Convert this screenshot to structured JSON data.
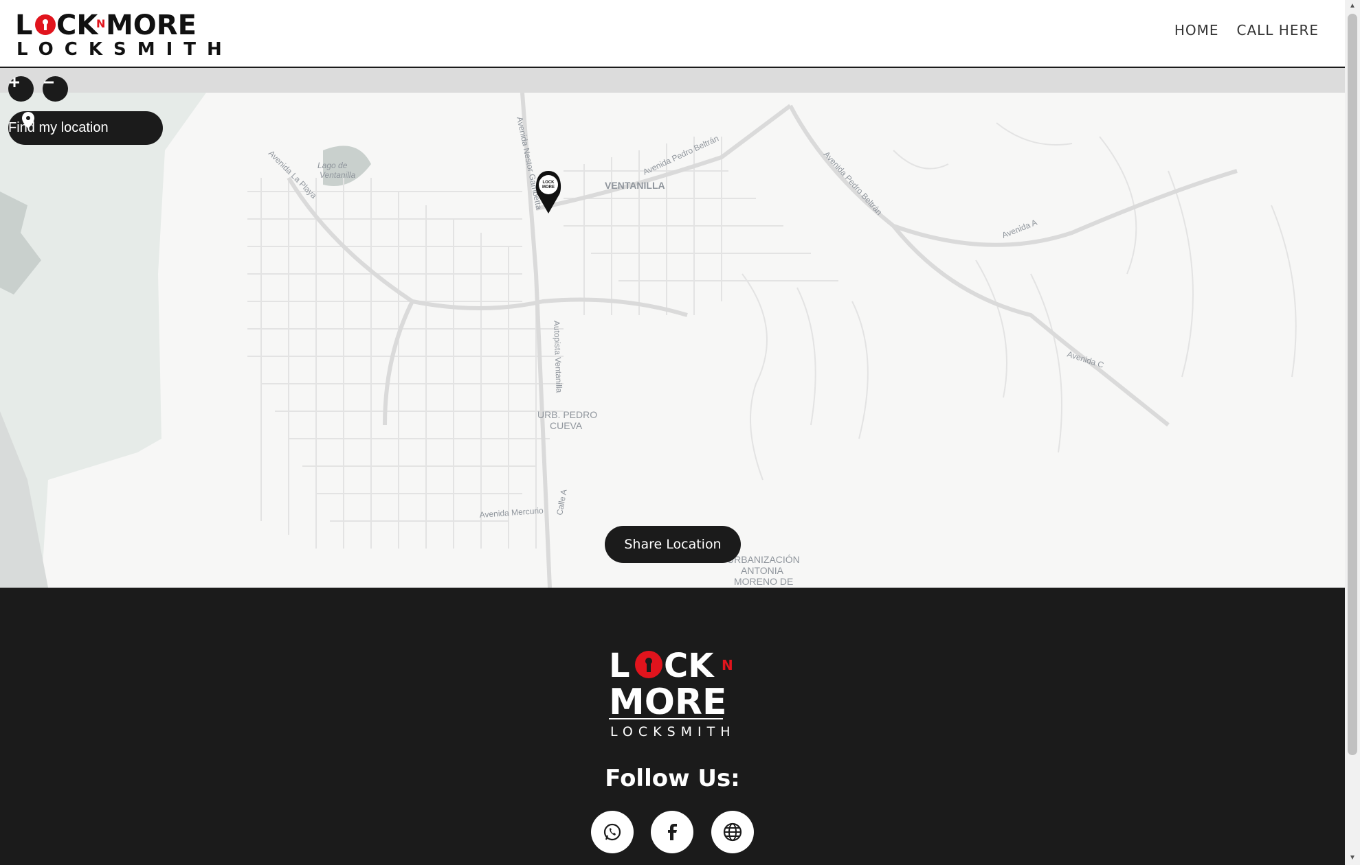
{
  "brand": {
    "logo_line1_a": "L",
    "logo_line1_b": "CK",
    "logo_line1_n": "N",
    "logo_line1_c": "MORE",
    "logo_line2": "LOCKSMITH",
    "accent": "#e1141d"
  },
  "nav": {
    "items": [
      {
        "label": "HOME"
      },
      {
        "label": "CALL HERE"
      }
    ]
  },
  "map": {
    "zoom_in_icon": "plus-icon",
    "zoom_out_icon": "minus-icon",
    "find_location_label": "Find my location",
    "share_location_label": "Share Location",
    "labels": {
      "lago": "Lago de",
      "lago2": "Ventanilla",
      "av_playa": "Avenida La Playa",
      "av_nestor": "Avenida Nestor Gambetta",
      "av_pedro1": "Avenida Pedro Beltrán",
      "av_pedro2": "Avenida Pedro Beltrán",
      "ventanilla": "VENTANILLA",
      "av_a": "Avenida A",
      "autopista": "Autopista Ventanilla",
      "av_c": "Avenida C",
      "urb1": "URB. PEDRO",
      "urb2": "CUEVA",
      "calle_a": "Calle A",
      "av_mercurio": "Avenida Mercurio",
      "urb_an1": "URBANIZACIÓN",
      "urb_an2": "ANTONIA",
      "urb_an3": "MORENO DE"
    },
    "marker_text1": "LOCK",
    "marker_text2": "MORE"
  },
  "footer": {
    "logo_top_a": "L",
    "logo_top_b": "CK",
    "logo_top_n": "N",
    "logo_mid": "MORE",
    "logo_bottom": "LOCKSMITH",
    "follow_label": "Follow Us:",
    "social": [
      {
        "icon": "whatsapp-icon"
      },
      {
        "icon": "facebook-icon"
      },
      {
        "icon": "globe-icon"
      }
    ]
  }
}
